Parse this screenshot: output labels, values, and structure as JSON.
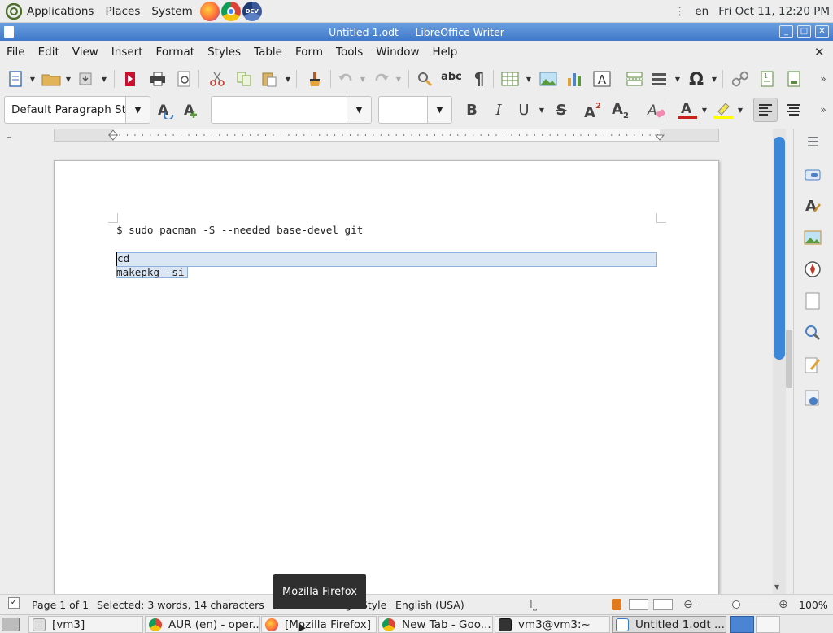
{
  "top_panel": {
    "applications": "Applications",
    "places": "Places",
    "system": "System",
    "launchers": [
      "firefox-icon",
      "chrome-icon",
      "chrome-dev-icon"
    ],
    "keyboard_layout": "en",
    "clock": "Fri Oct 11, 12:20 PM"
  },
  "window": {
    "title": "Untitled 1.odt — LibreOffice Writer"
  },
  "menubar": [
    "File",
    "Edit",
    "View",
    "Insert",
    "Format",
    "Styles",
    "Table",
    "Form",
    "Tools",
    "Window",
    "Help"
  ],
  "formatting": {
    "paragraph_style": "Default Paragraph Sty",
    "font_name": "",
    "font_size": ""
  },
  "document": {
    "lines": [
      "$ sudo pacman -S --needed base-devel git",
      "cd",
      "makepkg -si"
    ],
    "selection_color": "#dbe6f5"
  },
  "statusbar": {
    "page": "Page 1 of 1",
    "selection": "Selected: 3 words, 14 characters",
    "page_style": "Default Page Style",
    "language": "English (USA)",
    "zoom": "100%"
  },
  "taskbar": [
    {
      "label": "[vm3]"
    },
    {
      "label": "AUR (en) - oper..."
    },
    {
      "label": "[Mozilla Firefox]"
    },
    {
      "label": "New Tab - Goo..."
    },
    {
      "label": "vm3@vm3:~"
    },
    {
      "label": "Untitled 1.odt ..."
    }
  ],
  "tooltip": "Mozilla Firefox",
  "colors": {
    "accent": "#3d77c9",
    "titlebar": "#4a84d2"
  }
}
